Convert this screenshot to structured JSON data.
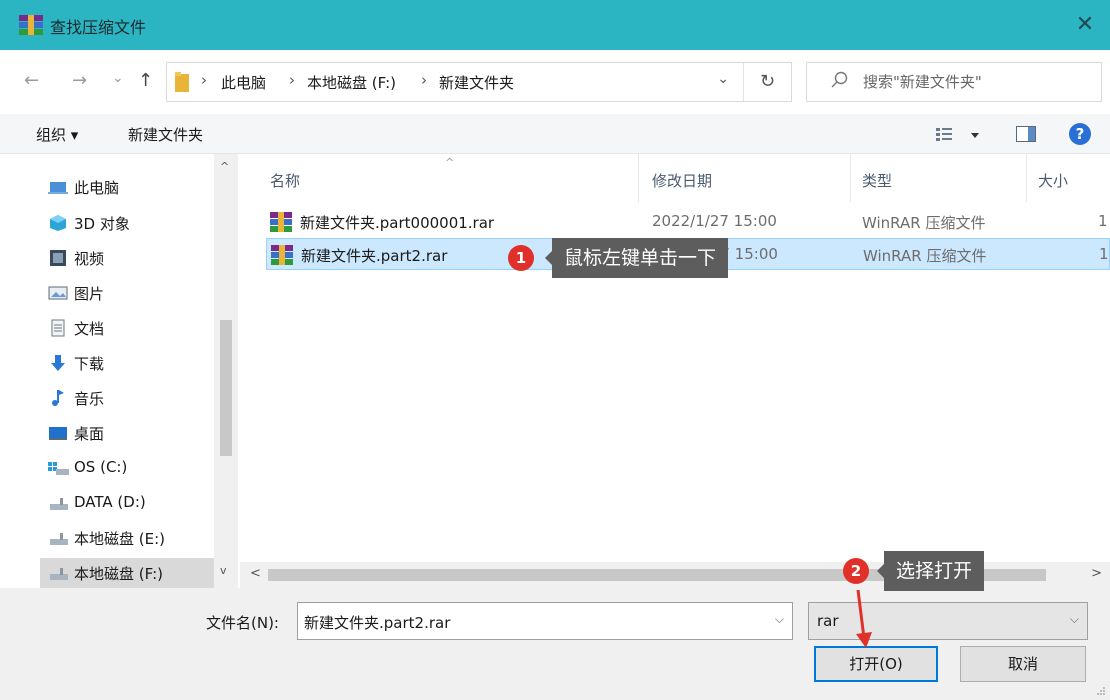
{
  "window": {
    "title": "查找压缩文件",
    "close_glyph": "✕"
  },
  "nav": {
    "back_glyph": "←",
    "forward_glyph": "→",
    "recent_glyph": "⌄",
    "up_glyph": "↑",
    "breadcrumbs": [
      "此电脑",
      "本地磁盘 (F:)",
      "新建文件夹"
    ],
    "separator": "›",
    "dropdown_glyph": "⌄",
    "refresh_glyph": "↻",
    "search_placeholder": "搜索\"新建文件夹\""
  },
  "toolbar": {
    "organize": "组织 ▾",
    "new_folder": "新建文件夹",
    "help": "?"
  },
  "sidebar": {
    "items": [
      {
        "label": "此电脑",
        "icon": "pc-icon"
      },
      {
        "label": "3D 对象",
        "icon": "3d-objects-icon"
      },
      {
        "label": "视频",
        "icon": "video-icon"
      },
      {
        "label": "图片",
        "icon": "pictures-icon"
      },
      {
        "label": "文档",
        "icon": "documents-icon"
      },
      {
        "label": "下载",
        "icon": "downloads-icon"
      },
      {
        "label": "音乐",
        "icon": "music-icon"
      },
      {
        "label": "桌面",
        "icon": "desktop-icon"
      },
      {
        "label": "OS (C:)",
        "icon": "drive-os-icon"
      },
      {
        "label": "DATA (D:)",
        "icon": "drive-icon"
      },
      {
        "label": "本地磁盘 (E:)",
        "icon": "drive-icon"
      },
      {
        "label": "本地磁盘 (F:)",
        "icon": "drive-icon",
        "selected": true
      }
    ],
    "scroll_up": "^",
    "scroll_down": "v"
  },
  "filelist": {
    "columns": [
      "名称",
      "修改日期",
      "类型",
      "大小"
    ],
    "sort_glyph": "^",
    "rows": [
      {
        "name": "新建文件夹.part000001.rar",
        "date": "2022/1/27 15:00",
        "type": "WinRAR 压缩文件",
        "size": "1"
      },
      {
        "name": "新建文件夹.part2.rar",
        "date": "2022/1/27 15:00",
        "type": "WinRAR 压缩文件",
        "size": "1",
        "selected": true
      }
    ],
    "hscroll_left": "<",
    "hscroll_right": ">"
  },
  "bottom": {
    "filename_label": "文件名(N):",
    "filename_value": "新建文件夹.part2.rar",
    "filetype_value": "rar",
    "open_button": "打开(O)",
    "cancel_button": "取消"
  },
  "annotations": [
    {
      "number": "1",
      "text": "鼠标左键单击一下"
    },
    {
      "number": "2",
      "text": "选择打开"
    }
  ],
  "colors": {
    "titlebar": "#2bb4c2",
    "selection": "#cce8ff",
    "badge": "#e0302a",
    "tooltip": "#5d5d5d",
    "arrow": "#e0302a"
  }
}
